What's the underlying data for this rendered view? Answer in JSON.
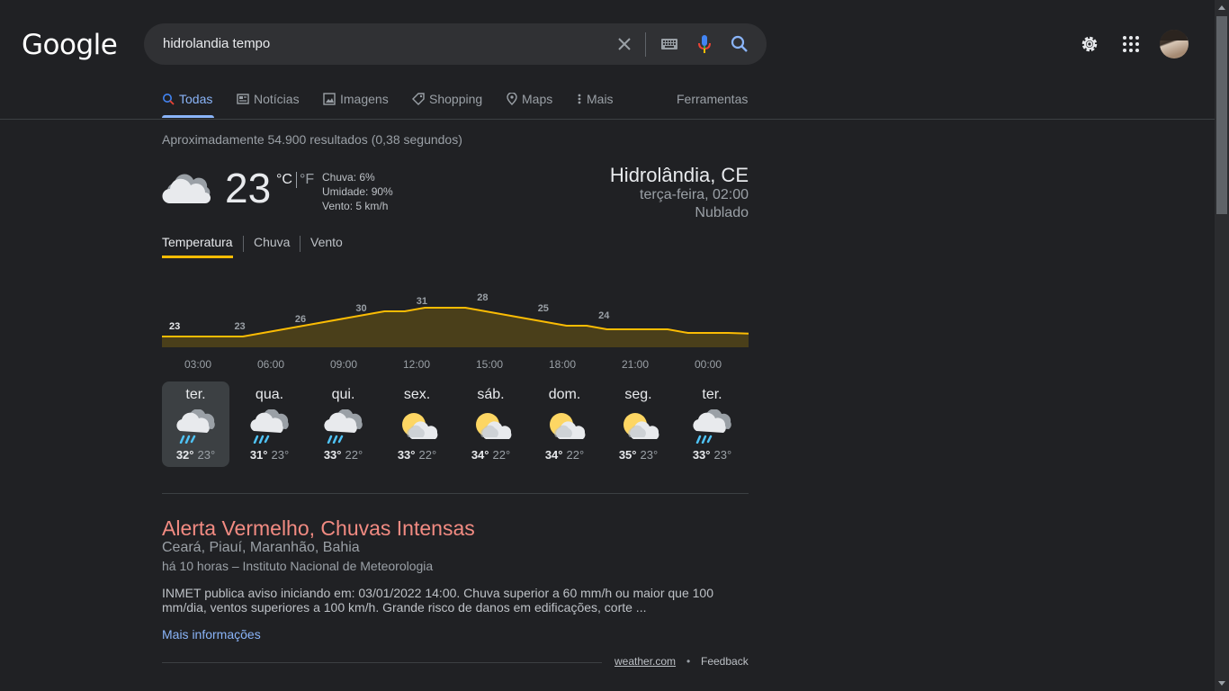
{
  "header": {
    "logo": "Google",
    "query": "hidrolandia tempo"
  },
  "tabs": [
    {
      "label": "Todas",
      "icon": "search-icon"
    },
    {
      "label": "Notícias",
      "icon": "news-icon"
    },
    {
      "label": "Imagens",
      "icon": "image-icon"
    },
    {
      "label": "Shopping",
      "icon": "tag-icon"
    },
    {
      "label": "Maps",
      "icon": "pin-icon"
    },
    {
      "label": "Mais",
      "icon": "more-vert-icon"
    }
  ],
  "tools_label": "Ferramentas",
  "result_stats": "Aproximadamente 54.900 resultados (0,38 segundos)",
  "weather": {
    "temp": "23",
    "unit_c": "°C",
    "unit_f": "°F",
    "chance": "Chuva: 6%",
    "humidity": "Umidade: 90%",
    "wind": "Vento: 5 km/h",
    "location": "Hidrolândia, CE",
    "datetime": "terça-feira, 02:00",
    "condition": "Nublado",
    "tabs": [
      "Temperatura",
      "Chuva",
      "Vento"
    ],
    "line_color": "#fbbc04"
  },
  "chart_data": {
    "type": "area",
    "title": "",
    "x": [
      "03:00",
      "06:00",
      "09:00",
      "12:00",
      "15:00",
      "18:00",
      "21:00",
      "00:00"
    ],
    "labels": [
      {
        "x": "02:00",
        "value": 23
      },
      {
        "x": "05:00",
        "value": 23
      },
      {
        "x": "08:00",
        "value": 26
      },
      {
        "x": "11:00",
        "value": 30
      },
      {
        "x": "14:00",
        "value": 31
      },
      {
        "x": "17:00",
        "value": 28
      },
      {
        "x": "20:00",
        "value": 25
      },
      {
        "x": "23:00",
        "value": 24
      }
    ],
    "series": [
      {
        "values": [
          23,
          23,
          23,
          23,
          23,
          24,
          25,
          26,
          27,
          28,
          29,
          30,
          30,
          31,
          31,
          31,
          30,
          29,
          28,
          27,
          26,
          26,
          25,
          25,
          25,
          25,
          24,
          24,
          24,
          23.8
        ]
      }
    ]
  },
  "forecast": [
    {
      "day": "ter.",
      "icon": "rain-cloud-icon",
      "hi": "32°",
      "lo": "23°"
    },
    {
      "day": "qua.",
      "icon": "rain-cloud-icon",
      "hi": "31°",
      "lo": "23°"
    },
    {
      "day": "qui.",
      "icon": "rain-cloud-icon",
      "hi": "33°",
      "lo": "22°"
    },
    {
      "day": "sex.",
      "icon": "partly-sunny-icon",
      "hi": "33°",
      "lo": "22°"
    },
    {
      "day": "sáb.",
      "icon": "partly-sunny-icon",
      "hi": "34°",
      "lo": "22°"
    },
    {
      "day": "dom.",
      "icon": "partly-sunny-icon",
      "hi": "34°",
      "lo": "22°"
    },
    {
      "day": "seg.",
      "icon": "partly-sunny-icon",
      "hi": "35°",
      "lo": "23°"
    },
    {
      "day": "ter.",
      "icon": "rain-cloud-icon",
      "hi": "33°",
      "lo": "23°"
    }
  ],
  "alert": {
    "title": "Alerta Vermelho, Chuvas Intensas",
    "regions": "Ceará, Piauí, Maranhão, Bahia",
    "source": "há 10 horas – Instituto Nacional de Meteorologia",
    "body": "INMET publica aviso iniciando em: 03/01/2022 14:00. Chuva superior a 60 mm/h ou maior que 100 mm/dia, ventos superiores a 100 km/h. Grande risco de danos em edificações, corte ...",
    "more": "Mais informações"
  },
  "footer": {
    "source": "weather.com",
    "dot": "•",
    "feedback": "Feedback"
  }
}
